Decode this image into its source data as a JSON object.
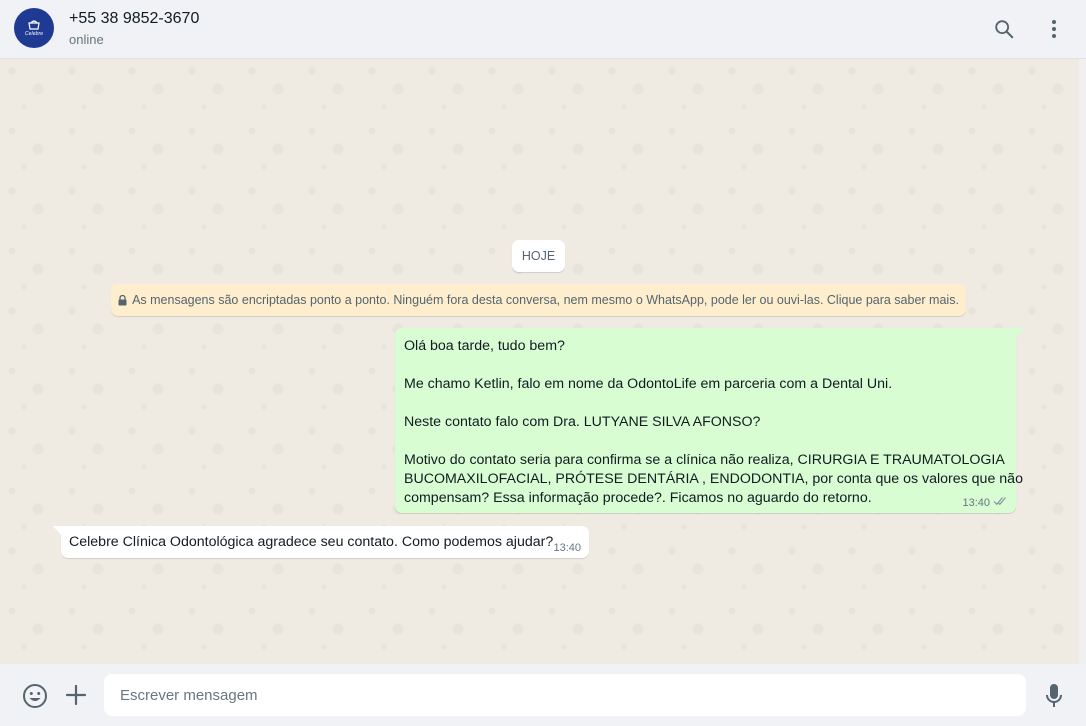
{
  "header": {
    "avatar_text": "Celebre",
    "contact_name": "+55 38 9852-3670",
    "status": "online",
    "icons": {
      "search": "search-icon",
      "menu": "kebab-menu-icon"
    }
  },
  "chat": {
    "date_chip": "HOJE",
    "encryption_notice": "As mensagens são encriptadas ponto a ponto. Ninguém fora desta conversa, nem mesmo o WhatsApp, pode ler ou ouvi-las. Clique para saber mais.",
    "outgoing": {
      "lines": [
        "Olá boa tarde, tudo bem?",
        "",
        "Me chamo Ketlin, falo em nome da OdontoLife em parceria com a Dental Uni.",
        "",
        "Neste contato falo com Dra. LUTYANE SILVA AFONSO?",
        "",
        "Motivo do contato seria para confirma se a clínica não realiza, CIRURGIA E TRAUMATOLOGIA",
        "BUCOMAXILOFACIAL, PRÓTESE DENTÁRIA , ENDODONTIA, por conta que os valores que não",
        "compensam? Essa informação procede?. Ficamos no aguardo do retorno."
      ],
      "time": "13:40",
      "status_icon": "double-check-icon"
    },
    "incoming": {
      "text": "Celebre Clínica Odontológica agradece seu contato. Como podemos ajudar?",
      "time": "13:40"
    }
  },
  "footer": {
    "placeholder": "Escrever mensagem",
    "value": "",
    "icons": {
      "emoji": "emoji-icon",
      "attach": "plus-icon",
      "mic": "microphone-icon"
    }
  },
  "colors": {
    "outgoing_bubble": "#d9fdd3",
    "incoming_bubble": "#ffffff",
    "chat_background": "#efeae2",
    "encryption_banner": "#ffeecd",
    "header_background": "#f0f2f5",
    "avatar_background": "#1f3a93",
    "read_ticks": "#8696a0"
  }
}
